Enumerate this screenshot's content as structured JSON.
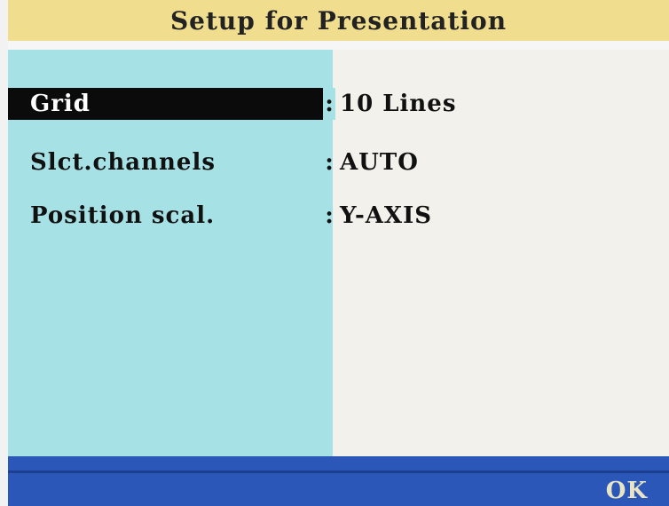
{
  "title": "Setup for Presentation",
  "settings": [
    {
      "label": "Grid",
      "separator": ":",
      "value": "10 Lines"
    },
    {
      "label": "Slct.channels",
      "separator": ":",
      "value": "AUTO"
    },
    {
      "label": "Position scal.",
      "separator": ":",
      "value": "Y-AXIS"
    }
  ],
  "selected_index": 0,
  "footer": {
    "ok_label": "OK"
  },
  "colors": {
    "title_bar": "#f0de8e",
    "label_panel": "#a6e2e5",
    "value_panel": "#f3f1eb",
    "footer_bar": "#2a57b8",
    "selection": "#0b0b0b"
  }
}
